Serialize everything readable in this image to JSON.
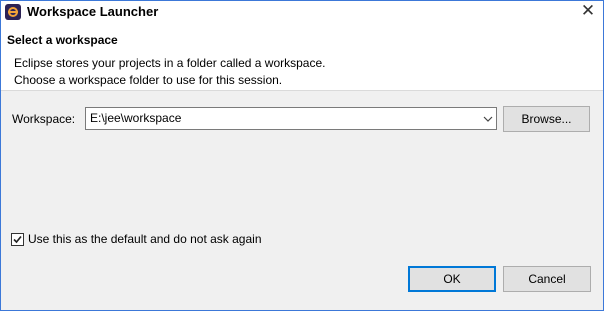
{
  "window": {
    "title": "Workspace Launcher",
    "close_glyph": "✕"
  },
  "header": {
    "title": "Select a workspace",
    "description_line1": "Eclipse stores your projects in a folder called a workspace.",
    "description_line2": "Choose a workspace folder to use for this session."
  },
  "workspace": {
    "label": "Workspace:",
    "value": "E:\\jee\\workspace",
    "browse_label": "Browse..."
  },
  "default_option": {
    "label": "Use this as the default and do not ask again",
    "checked": true
  },
  "buttons": {
    "ok_label": "OK",
    "cancel_label": "Cancel"
  },
  "icons": {
    "app": "eclipse-icon",
    "close": "close-icon",
    "dropdown": "chevron-down-icon",
    "check": "checkmark-icon"
  },
  "colors": {
    "default_button_border": "#0078d7",
    "window_border": "#3c78d8"
  }
}
